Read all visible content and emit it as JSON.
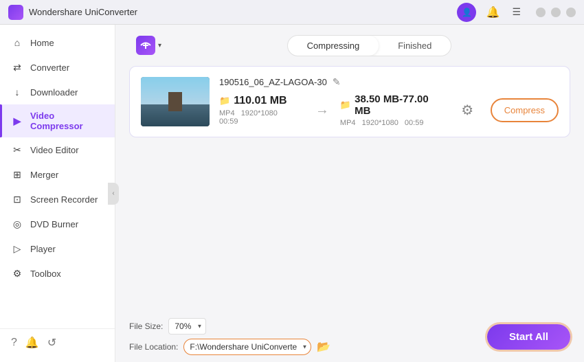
{
  "app": {
    "title": "Wondershare UniConverter",
    "logo_icon": "🎬"
  },
  "titlebar": {
    "profile_icon": "👤",
    "bell_icon": "🔔",
    "menu_icon": "☰",
    "minimize_icon": "—",
    "maximize_icon": "□",
    "close_icon": "✕"
  },
  "sidebar": {
    "items": [
      {
        "id": "home",
        "label": "Home",
        "icon": "⌂"
      },
      {
        "id": "converter",
        "label": "Converter",
        "icon": "⇄"
      },
      {
        "id": "downloader",
        "label": "Downloader",
        "icon": "↓"
      },
      {
        "id": "video-compressor",
        "label": "Video Compressor",
        "icon": "▶",
        "active": true
      },
      {
        "id": "video-editor",
        "label": "Video Editor",
        "icon": "✂"
      },
      {
        "id": "merger",
        "label": "Merger",
        "icon": "⊞"
      },
      {
        "id": "screen-recorder",
        "label": "Screen Recorder",
        "icon": "⊡"
      },
      {
        "id": "dvd-burner",
        "label": "DVD Burner",
        "icon": "◎"
      },
      {
        "id": "player",
        "label": "Player",
        "icon": "▷"
      },
      {
        "id": "toolbox",
        "label": "Toolbox",
        "icon": "⚙"
      }
    ],
    "footer_icons": [
      "?",
      "🔔",
      "↺"
    ]
  },
  "toolbar": {
    "add_button_label": "+",
    "caret": "▾"
  },
  "tabs": {
    "compressing": "Compressing",
    "finished": "Finished"
  },
  "file_card": {
    "filename": "190516_06_AZ-LAGOA-30",
    "edit_icon": "✎",
    "source": {
      "folder_icon": "📁",
      "size": "110.01 MB",
      "format": "MP4",
      "resolution": "1920*1080",
      "duration": "00:59"
    },
    "arrow": "→",
    "settings_icon": "⚙",
    "output": {
      "folder_icon": "📁",
      "size": "38.50 MB-77.00 MB",
      "format": "MP4",
      "resolution": "1920*1080",
      "duration": "00:59"
    },
    "compress_button": "Compress"
  },
  "bottom_bar": {
    "file_size_label": "File Size:",
    "file_size_value": "70%",
    "file_location_label": "File Location:",
    "file_location_value": "F:\\Wondershare UniConverte",
    "folder_icon": "📂",
    "start_all_button": "Start All"
  }
}
